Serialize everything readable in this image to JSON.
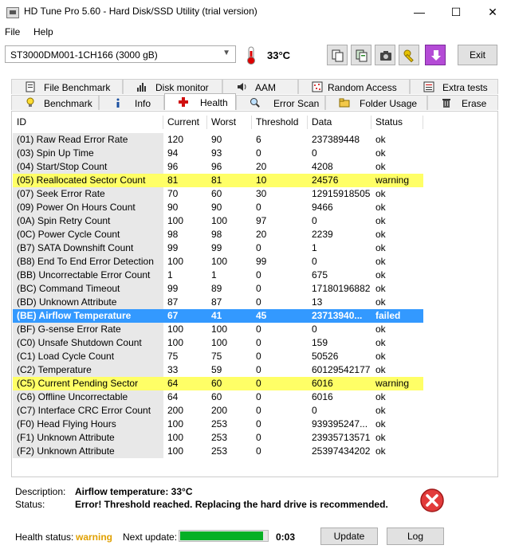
{
  "window": {
    "title": "HD Tune Pro 5.60 - Hard Disk/SSD Utility (trial version)",
    "minimize": "—",
    "maximize": "☐",
    "close": "✕"
  },
  "menu": {
    "file": "File",
    "help": "Help"
  },
  "toolbar": {
    "drive": "ST3000DM001-1CH166 (3000 gB)",
    "temperature": "33°C",
    "exit_label": "Exit"
  },
  "tabs_top": [
    {
      "label": "File Benchmark",
      "icon": "file-benchmark-icon"
    },
    {
      "label": "Disk monitor",
      "icon": "disk-monitor-icon"
    },
    {
      "label": "AAM",
      "icon": "speaker-icon"
    },
    {
      "label": "Random Access",
      "icon": "random-access-icon"
    },
    {
      "label": "Extra tests",
      "icon": "extra-tests-icon"
    }
  ],
  "tabs_bottom": [
    {
      "label": "Benchmark",
      "icon": "lightbulb-icon"
    },
    {
      "label": "Info",
      "icon": "info-icon"
    },
    {
      "label": "Health",
      "icon": "health-cross-icon",
      "active": true
    },
    {
      "label": "Error Scan",
      "icon": "magnifier-icon"
    },
    {
      "label": "Folder Usage",
      "icon": "folder-icon"
    },
    {
      "label": "Erase",
      "icon": "trash-icon"
    }
  ],
  "table": {
    "headers": [
      "ID",
      "Current",
      "Worst",
      "Threshold",
      "Data",
      "Status"
    ],
    "rows": [
      {
        "cells": [
          "(01) Raw Read Error Rate",
          "120",
          "90",
          "6",
          "237389448",
          "ok"
        ],
        "state": "ok"
      },
      {
        "cells": [
          "(03) Spin Up Time",
          "94",
          "93",
          "0",
          "0",
          "ok"
        ],
        "state": "ok"
      },
      {
        "cells": [
          "(04) Start/Stop Count",
          "96",
          "96",
          "20",
          "4208",
          "ok"
        ],
        "state": "ok"
      },
      {
        "cells": [
          "(05) Reallocated Sector Count",
          "81",
          "81",
          "10",
          "24576",
          "warning"
        ],
        "state": "warn"
      },
      {
        "cells": [
          "(07) Seek Error Rate",
          "70",
          "60",
          "30",
          "12915918505",
          "ok"
        ],
        "state": "ok"
      },
      {
        "cells": [
          "(09) Power On Hours Count",
          "90",
          "90",
          "0",
          "9466",
          "ok"
        ],
        "state": "ok"
      },
      {
        "cells": [
          "(0A) Spin Retry Count",
          "100",
          "100",
          "97",
          "0",
          "ok"
        ],
        "state": "ok"
      },
      {
        "cells": [
          "(0C) Power Cycle Count",
          "98",
          "98",
          "20",
          "2239",
          "ok"
        ],
        "state": "ok"
      },
      {
        "cells": [
          "(B7) SATA Downshift Count",
          "99",
          "99",
          "0",
          "1",
          "ok"
        ],
        "state": "ok"
      },
      {
        "cells": [
          "(B8) End To End Error Detection",
          "100",
          "100",
          "99",
          "0",
          "ok"
        ],
        "state": "ok"
      },
      {
        "cells": [
          "(BB) Uncorrectable Error Count",
          "1",
          "1",
          "0",
          "675",
          "ok"
        ],
        "state": "ok"
      },
      {
        "cells": [
          "(BC) Command Timeout",
          "99",
          "89",
          "0",
          "17180196882",
          "ok"
        ],
        "state": "ok"
      },
      {
        "cells": [
          "(BD) Unknown Attribute",
          "87",
          "87",
          "0",
          "13",
          "ok"
        ],
        "state": "ok"
      },
      {
        "cells": [
          "(BE) Airflow Temperature",
          "67",
          "41",
          "45",
          "23713940...",
          "failed"
        ],
        "state": "fail"
      },
      {
        "cells": [
          "(BF) G-sense Error Rate",
          "100",
          "100",
          "0",
          "0",
          "ok"
        ],
        "state": "ok"
      },
      {
        "cells": [
          "(C0) Unsafe Shutdown Count",
          "100",
          "100",
          "0",
          "159",
          "ok"
        ],
        "state": "ok"
      },
      {
        "cells": [
          "(C1) Load Cycle Count",
          "75",
          "75",
          "0",
          "50526",
          "ok"
        ],
        "state": "ok"
      },
      {
        "cells": [
          "(C2) Temperature",
          "33",
          "59",
          "0",
          "60129542177",
          "ok"
        ],
        "state": "ok"
      },
      {
        "cells": [
          "(C5) Current Pending Sector",
          "64",
          "60",
          "0",
          "6016",
          "warning"
        ],
        "state": "warn"
      },
      {
        "cells": [
          "(C6) Offline Uncorrectable",
          "64",
          "60",
          "0",
          "6016",
          "ok"
        ],
        "state": "ok"
      },
      {
        "cells": [
          "(C7) Interface CRC Error Count",
          "200",
          "200",
          "0",
          "0",
          "ok"
        ],
        "state": "ok"
      },
      {
        "cells": [
          "(F0) Head Flying Hours",
          "100",
          "253",
          "0",
          "939395247...",
          "ok"
        ],
        "state": "ok"
      },
      {
        "cells": [
          "(F1) Unknown Attribute",
          "100",
          "253",
          "0",
          "23935713571",
          "ok"
        ],
        "state": "ok"
      },
      {
        "cells": [
          "(F2) Unknown Attribute",
          "100",
          "253",
          "0",
          "25397434202",
          "ok"
        ],
        "state": "ok"
      }
    ]
  },
  "details": {
    "description_label": "Description:",
    "description": "Airflow temperature: 33°C",
    "status_label": "Status:",
    "status": "Error! Threshold reached. Replacing the hard drive is recommended."
  },
  "statusbar": {
    "health_label": "Health status:",
    "health_value": "warning",
    "next_update_label": "Next update:",
    "progress_fraction": 0.95,
    "countdown": "0:03",
    "update_label": "Update",
    "log_label": "Log"
  },
  "colors": {
    "warning_row": "#ffff66",
    "failed_row": "#3399ff",
    "progress": "#06b025",
    "health_warning": "#e0a000"
  }
}
